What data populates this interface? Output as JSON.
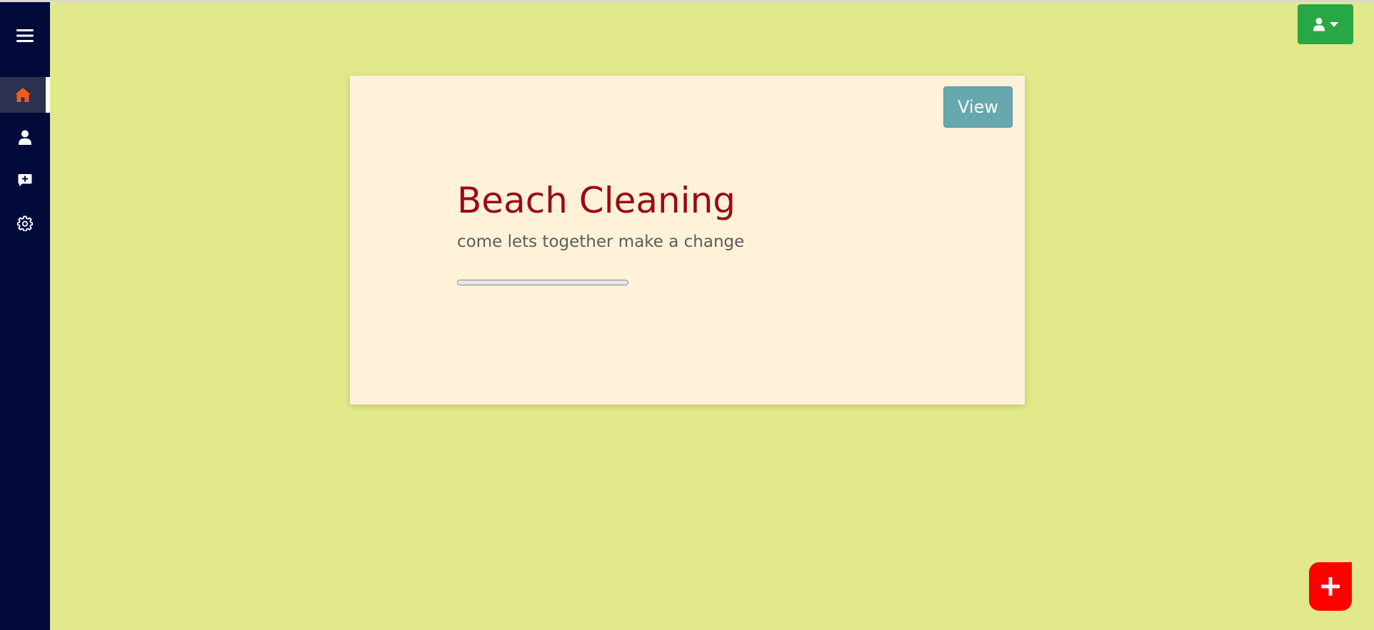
{
  "sidebar": {
    "items": [
      {
        "icon": "menu-icon"
      },
      {
        "icon": "home-icon",
        "active": true,
        "color": "#f05a1a"
      },
      {
        "icon": "user-icon"
      },
      {
        "icon": "feedback-icon"
      },
      {
        "icon": "gear-icon"
      }
    ]
  },
  "header": {
    "user_menu": {
      "icon": "user-icon",
      "caret": "caret-down-icon",
      "color": "#28a745"
    }
  },
  "card": {
    "view_label": "View",
    "title": "Beach Cleaning",
    "subtitle": "come lets together make a change",
    "progress": 0
  },
  "fab": {
    "icon": "plus-icon",
    "color": "#ff0000"
  },
  "colors": {
    "background": "#e2e98a",
    "sidebar": "#020a3a",
    "card": "#fff2d8",
    "title": "#9a0b16",
    "view_button": "#66a8ae"
  }
}
